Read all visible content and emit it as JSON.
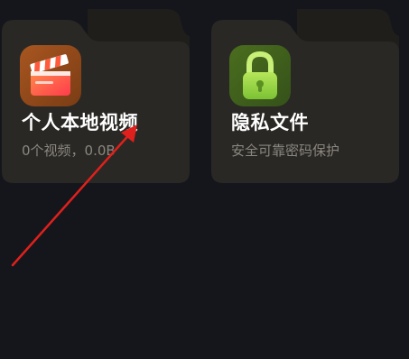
{
  "folders": [
    {
      "title": "个人本地视频",
      "subtitle": "0个视频，0.0B",
      "icon": "clapperboard-icon"
    },
    {
      "title": "隐私文件",
      "subtitle": "安全可靠密码保护",
      "icon": "lock-icon"
    }
  ],
  "colors": {
    "background": "#15161b",
    "folder_front": "#2a2824",
    "folder_back": "#1f1e1b",
    "title_text": "#ffffff",
    "subtitle_text": "#8a8780",
    "annotation_arrow": "#e0201c"
  }
}
